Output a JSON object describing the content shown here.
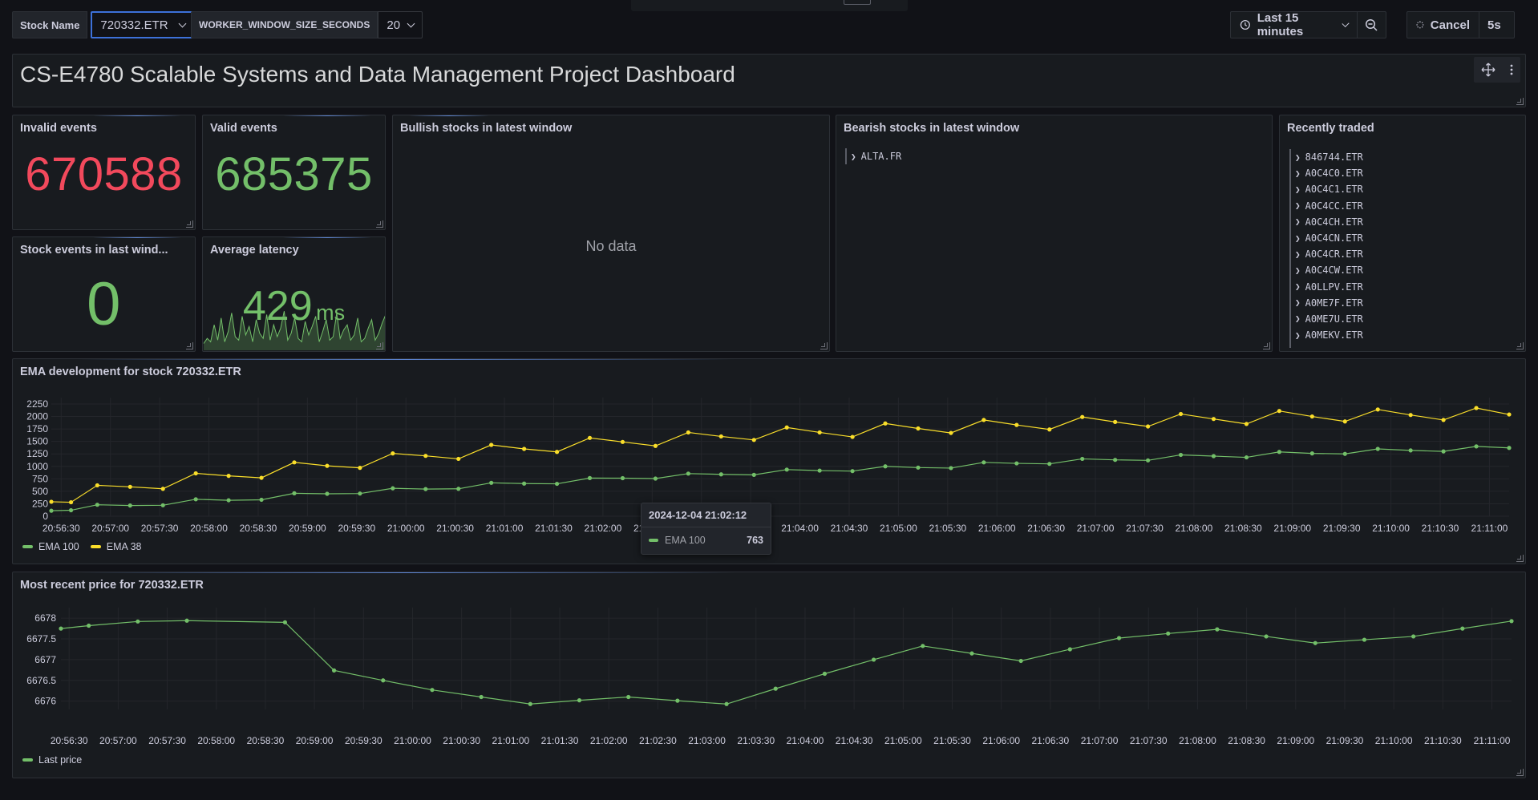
{
  "toolbar": {
    "stock_label": "Stock Name",
    "stock_value": "720332.ETR",
    "window_label": "WORKER_WINDOW_SIZE_SECONDS",
    "window_value": "20",
    "time_range": "Last 15 minutes",
    "cancel_label": "Cancel",
    "refresh_interval": "5s"
  },
  "dashboard": {
    "title": "CS-E4780 Scalable Systems and Data Management Project Dashboard"
  },
  "stats": {
    "invalid": {
      "title": "Invalid events",
      "value": "670588",
      "color": "#f2495c"
    },
    "valid": {
      "title": "Valid events",
      "value": "685375",
      "color": "#73bf69"
    },
    "stock_events": {
      "title": "Stock events in last wind...",
      "value": "0",
      "color": "#73bf69"
    },
    "latency": {
      "title": "Average latency",
      "value": "429",
      "unit": "ms",
      "color": "#73bf69",
      "sparkline": [
        8,
        14,
        10,
        30,
        12,
        38,
        10,
        22,
        44,
        16,
        12,
        40,
        18,
        28,
        10,
        36,
        20,
        14,
        42,
        12,
        30,
        16,
        26,
        46,
        12,
        20,
        38,
        14,
        10,
        34,
        18,
        28,
        40,
        10,
        22,
        36,
        12,
        16,
        44,
        14,
        24,
        30,
        12,
        18,
        38,
        10,
        14,
        26,
        36,
        12,
        20,
        32,
        42
      ]
    }
  },
  "bullish": {
    "title": "Bullish stocks in latest window",
    "empty_text": "No data"
  },
  "bearish": {
    "title": "Bearish stocks in latest window",
    "items": [
      "ALTA.FR"
    ]
  },
  "recent": {
    "title": "Recently traded",
    "items": [
      "846744.ETR",
      "A0C4C0.ETR",
      "A0C4C1.ETR",
      "A0C4CC.ETR",
      "A0C4CH.ETR",
      "A0C4CN.ETR",
      "A0C4CR.ETR",
      "A0C4CW.ETR",
      "A0LLPV.ETR",
      "A0ME7F.ETR",
      "A0ME7U.ETR",
      "A0MEKV.ETR"
    ]
  },
  "ema_panel": {
    "title": "EMA development for stock 720332.ETR",
    "tooltip": {
      "time": "2024-12-04 21:02:12",
      "series": "EMA 100",
      "value": "763"
    },
    "legend": [
      {
        "name": "EMA 100",
        "color": "#73bf69"
      },
      {
        "name": "EMA 38",
        "color": "#fade2a"
      }
    ]
  },
  "price_panel": {
    "title": "Most recent price for 720332.ETR",
    "legend": [
      {
        "name": "Last price",
        "color": "#73bf69"
      }
    ]
  },
  "chart_data": [
    {
      "type": "line",
      "title": "EMA development for stock 720332.ETR",
      "ylim": [
        0,
        2250
      ],
      "yticks": [
        0,
        250,
        500,
        750,
        1000,
        1250,
        1500,
        1750,
        2000,
        2250
      ],
      "x_tick_labels": [
        "20:56:30",
        "20:57:00",
        "20:57:30",
        "20:58:00",
        "20:58:30",
        "20:59:00",
        "20:59:30",
        "21:00:00",
        "21:00:30",
        "21:01:00",
        "21:01:30",
        "21:02:00",
        "21:02:30",
        "21:03:00",
        "21:03:30",
        "21:04:00",
        "21:04:30",
        "21:05:00",
        "21:05:30",
        "21:06:00",
        "21:06:30",
        "21:07:00",
        "21:07:30",
        "21:08:00",
        "21:08:30",
        "21:09:00",
        "21:09:30",
        "21:10:00",
        "21:10:30",
        "21:11:00"
      ],
      "x": [
        "20:56:24",
        "20:56:36",
        "20:56:52",
        "20:57:12",
        "20:57:32",
        "20:57:52",
        "20:58:12",
        "20:58:32",
        "20:58:52",
        "20:59:12",
        "20:59:32",
        "20:59:52",
        "21:00:12",
        "21:00:32",
        "21:00:52",
        "21:01:12",
        "21:01:32",
        "21:01:52",
        "21:02:12",
        "21:02:32",
        "21:02:52",
        "21:03:12",
        "21:03:32",
        "21:03:52",
        "21:04:12",
        "21:04:32",
        "21:04:52",
        "21:05:12",
        "21:05:32",
        "21:05:52",
        "21:06:12",
        "21:06:32",
        "21:06:52",
        "21:07:12",
        "21:07:32",
        "21:07:52",
        "21:08:12",
        "21:08:32",
        "21:08:52",
        "21:09:12",
        "21:09:32",
        "21:09:52",
        "21:10:12",
        "21:10:32",
        "21:10:52",
        "21:11:12"
      ],
      "series": [
        {
          "name": "EMA 100",
          "color": "#73bf69",
          "values": [
            110,
            120,
            230,
            215,
            220,
            340,
            320,
            330,
            460,
            450,
            455,
            560,
            545,
            550,
            670,
            655,
            650,
            765,
            763,
            755,
            855,
            840,
            830,
            935,
            915,
            905,
            1000,
            975,
            965,
            1080,
            1060,
            1050,
            1150,
            1130,
            1120,
            1230,
            1205,
            1180,
            1290,
            1260,
            1250,
            1350,
            1320,
            1300,
            1400,
            1370
          ]
        },
        {
          "name": "EMA 38",
          "color": "#fade2a",
          "values": [
            290,
            280,
            620,
            590,
            550,
            860,
            810,
            770,
            1080,
            1010,
            970,
            1260,
            1210,
            1150,
            1430,
            1350,
            1290,
            1570,
            1490,
            1410,
            1680,
            1600,
            1530,
            1780,
            1680,
            1590,
            1860,
            1760,
            1670,
            1930,
            1830,
            1740,
            1990,
            1890,
            1800,
            2050,
            1950,
            1850,
            2110,
            2000,
            1900,
            2140,
            2030,
            1930,
            2170,
            2040
          ]
        }
      ]
    },
    {
      "type": "line",
      "title": "Most recent price for 720332.ETR",
      "ylim": [
        6675.8,
        6678.1
      ],
      "yticks": [
        6676,
        6676.5,
        6677,
        6677.5,
        6678
      ],
      "x_tick_labels": [
        "20:56:30",
        "20:57:00",
        "20:57:30",
        "20:58:00",
        "20:58:30",
        "20:59:00",
        "20:59:30",
        "21:00:00",
        "21:00:30",
        "21:01:00",
        "21:01:30",
        "21:02:00",
        "21:02:30",
        "21:03:00",
        "21:03:30",
        "21:04:00",
        "21:04:30",
        "21:05:00",
        "21:05:30",
        "21:06:00",
        "21:06:30",
        "21:07:00",
        "21:07:30",
        "21:08:00",
        "21:08:30",
        "21:09:00",
        "21:09:30",
        "21:10:00",
        "21:10:30",
        "21:11:00"
      ],
      "x": [
        "20:56:25",
        "20:56:42",
        "20:57:12",
        "20:57:42",
        "20:58:42",
        "20:59:12",
        "20:59:42",
        "21:00:12",
        "21:00:42",
        "21:01:12",
        "21:01:42",
        "21:02:12",
        "21:02:42",
        "21:03:12",
        "21:03:42",
        "21:04:12",
        "21:04:42",
        "21:05:12",
        "21:05:42",
        "21:06:12",
        "21:06:42",
        "21:07:12",
        "21:07:42",
        "21:08:12",
        "21:08:42",
        "21:09:12",
        "21:09:42",
        "21:10:12",
        "21:10:42",
        "21:11:12"
      ],
      "series": [
        {
          "name": "Last price",
          "color": "#73bf69",
          "values": [
            6677.75,
            6677.82,
            6677.92,
            6677.94,
            6677.9,
            6676.74,
            6676.5,
            6676.27,
            6676.1,
            6675.93,
            6676.02,
            6676.1,
            6676.01,
            6675.93,
            6676.3,
            6676.66,
            6677.0,
            6677.33,
            6677.15,
            6676.97,
            6677.25,
            6677.52,
            6677.63,
            6677.73,
            6677.56,
            6677.4,
            6677.48,
            6677.56,
            6677.75,
            6677.93
          ]
        }
      ]
    }
  ]
}
